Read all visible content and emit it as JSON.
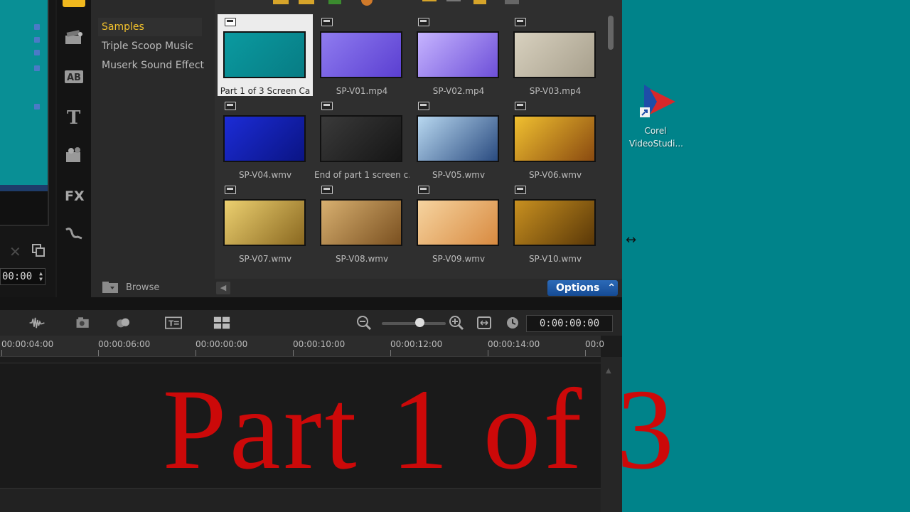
{
  "library": {
    "folders": [
      {
        "label": "Samples",
        "selected": true
      },
      {
        "label": "Triple Scoop Music",
        "selected": false
      },
      {
        "label": "Muserk Sound Effect",
        "selected": false
      }
    ],
    "browse_label": "Browse",
    "options_label": "Options",
    "thumbnails": [
      {
        "label": "Part 1 of 3 Screen Ca",
        "selected": true,
        "colors": [
          "#0a9aa0",
          "#087c84"
        ]
      },
      {
        "label": "SP-V01.mp4",
        "selected": false,
        "colors": [
          "#8f7cf0",
          "#5b3fd1"
        ]
      },
      {
        "label": "SP-V02.mp4",
        "selected": false,
        "colors": [
          "#c6b4ff",
          "#6d4fd8"
        ]
      },
      {
        "label": "SP-V03.mp4",
        "selected": false,
        "colors": [
          "#d8d1bf",
          "#a79f8c"
        ]
      },
      {
        "label": "SP-V04.wmv",
        "selected": false,
        "colors": [
          "#1c2cd6",
          "#0a1484"
        ]
      },
      {
        "label": "End of part 1 screen c...",
        "selected": false,
        "colors": [
          "#3a3a3a",
          "#151515"
        ]
      },
      {
        "label": "SP-V05.wmv",
        "selected": false,
        "colors": [
          "#b8d8f0",
          "#2a4b80"
        ]
      },
      {
        "label": "SP-V06.wmv",
        "selected": false,
        "colors": [
          "#f0c030",
          "#8a4a10"
        ]
      },
      {
        "label": "SP-V07.wmv",
        "selected": false,
        "colors": [
          "#ecd070",
          "#8a6820"
        ]
      },
      {
        "label": "SP-V08.wmv",
        "selected": false,
        "colors": [
          "#d8b070",
          "#7a5020"
        ]
      },
      {
        "label": "SP-V09.wmv",
        "selected": false,
        "colors": [
          "#f6d4a0",
          "#d88a40"
        ]
      },
      {
        "label": "SP-V10.wmv",
        "selected": false,
        "colors": [
          "#c89020",
          "#5a3808"
        ]
      }
    ]
  },
  "preview": {
    "timecode": "00:00"
  },
  "timeline": {
    "timecode": "0:00:00:00",
    "ruler_ticks": [
      "00:00:04:00",
      "00:00:06:00",
      "00:00:00:00",
      "00:00:10:00",
      "00:00:12:00",
      "00:00:14:00",
      "00:0"
    ]
  },
  "desktop": {
    "icon_label_line1": "Corel",
    "icon_label_line2": "VideoStudi..."
  },
  "overlay": {
    "title": "Part 1 of 3"
  },
  "colors": {
    "accent": "#f2c12c",
    "options_button": "#1f5fab",
    "overlay_text": "#cc0909",
    "desktop": "#00838a"
  }
}
